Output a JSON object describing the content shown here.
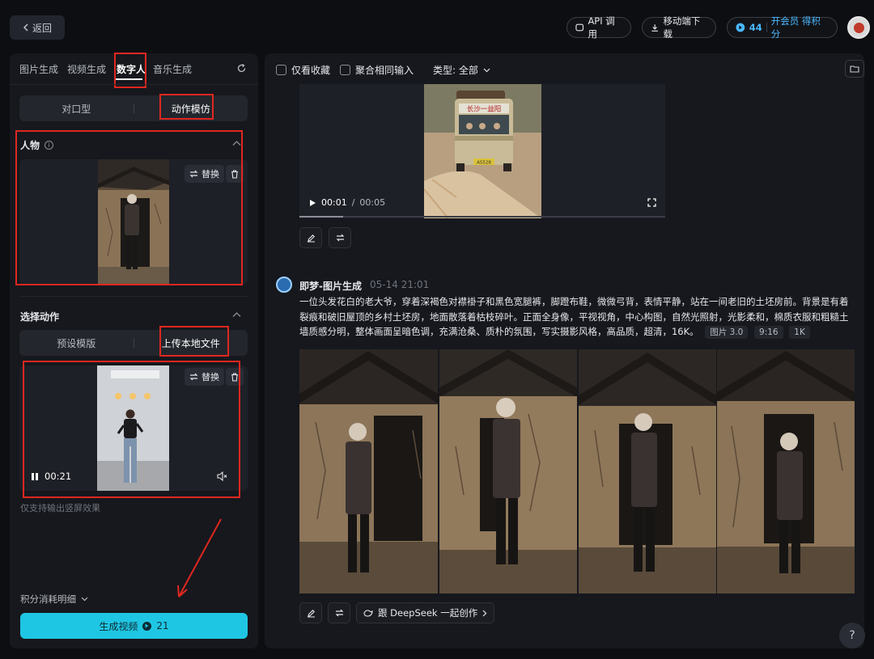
{
  "topbar": {
    "back_label": "返回",
    "api_label": "API 调用",
    "mobile_label": "移动端下载",
    "credits": "44",
    "vip_label": "开会员 得积分"
  },
  "left": {
    "tabs": [
      "图片生成",
      "视频生成",
      "数字人",
      "音乐生成"
    ],
    "mode_options": [
      "对口型",
      "动作模仿"
    ],
    "person_section": "人物",
    "replace_label": "替换",
    "action_section": "选择动作",
    "action_options": [
      "预设模版",
      "上传本地文件"
    ],
    "video_time": "00:21",
    "note": "仅支持输出竖屏效果",
    "cost_toggle": "积分消耗明细",
    "generate_label": "生成视频",
    "generate_cost": "21"
  },
  "right": {
    "filter_fav": "仅看收藏",
    "filter_merge": "聚合相同输入",
    "filter_type": "类型: 全部",
    "video": {
      "current": "00:01",
      "separator": "/",
      "total": "00:05",
      "bus_sign": "长沙一益阳",
      "plate": "A5528",
      "progress": 0.12
    },
    "message": {
      "sender": "即梦-图片生成",
      "date": "05-14",
      "time": "21:01",
      "prompt": "一位头发花白的老大爷，穿着深褐色对襟褂子和黑色宽腿裤，脚蹬布鞋，微微弓背，表情平静，站在一间老旧的土坯房前。背景是有着裂痕和破旧屋顶的乡村土坯房，地面散落着枯枝碎叶。正面全身像，平视视角，中心构图，自然光照射，光影柔和，棉质衣服和粗糙土墙质感分明，整体画面呈暗色调，充满沧桑、质朴的氛围，写实摄影风格，高品质，超清，16K。",
      "tags": [
        "图片 3.0",
        "9:16",
        "1K"
      ]
    },
    "deepseek_label": "跟 DeepSeek 一起创作"
  },
  "help_label": "?",
  "colors": {
    "accent": "#1fc6e3",
    "annotation": "#e0271f",
    "panel": "#16181d"
  }
}
